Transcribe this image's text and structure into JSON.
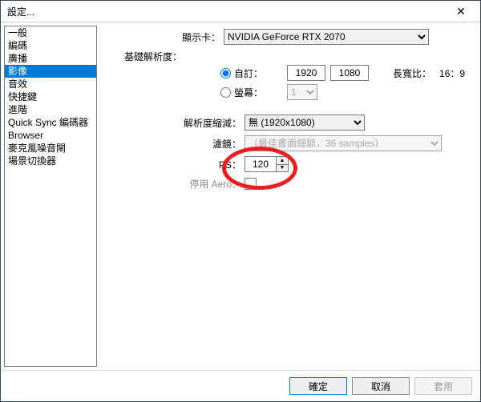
{
  "window": {
    "title": "設定..."
  },
  "sidebar": {
    "items": [
      {
        "label": "一般",
        "selected": false
      },
      {
        "label": "編碼",
        "selected": false
      },
      {
        "label": "廣播",
        "selected": false
      },
      {
        "label": "影像",
        "selected": true
      },
      {
        "label": "音效",
        "selected": false
      },
      {
        "label": "快捷鍵",
        "selected": false
      },
      {
        "label": "進階",
        "selected": false
      },
      {
        "label": "Quick Sync 編碼器",
        "selected": false
      },
      {
        "label": "Browser",
        "selected": false
      },
      {
        "label": "麥克風噪音閘",
        "selected": false
      },
      {
        "label": "場景切換器",
        "selected": false
      }
    ]
  },
  "form": {
    "display_card_label": "顯示卡：",
    "display_card_value": "NVIDIA GeForce RTX 2070",
    "base_res_label": "基礎解析度：",
    "radio_custom": "自訂：",
    "radio_monitor": "螢幕：",
    "custom_w": "1920",
    "custom_h": "1080",
    "aspect_label": "長寬比：",
    "aspect_value": "16：9",
    "monitor_value": "1",
    "scale_label": "解析度縮減：",
    "scale_value": "無  (1920x1080)",
    "filter_label": "濾鏡：",
    "filter_value": "（最佳畫面細節，36 samples）",
    "fps_label": "PS：",
    "fps_value": "120",
    "aero_label": "停用 Aero："
  },
  "buttons": {
    "ok": "確定",
    "cancel": "取消",
    "apply": "套用"
  }
}
